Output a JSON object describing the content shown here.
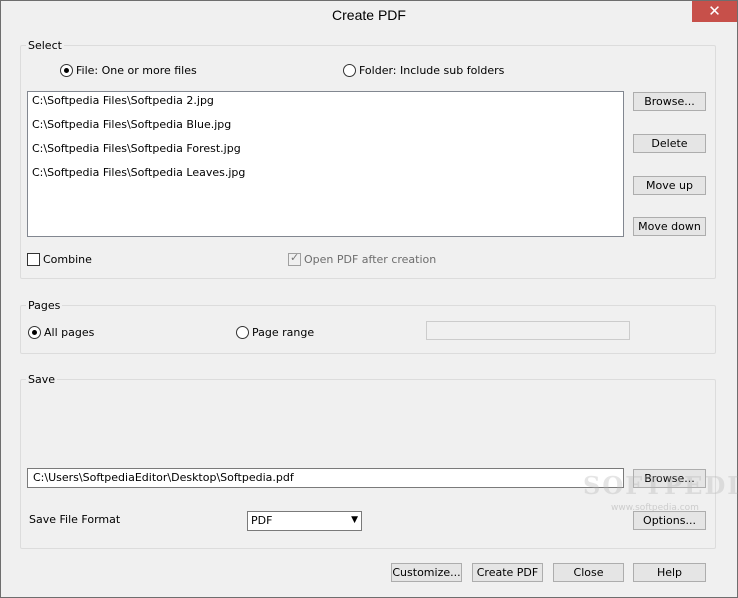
{
  "window": {
    "title": "Create PDF",
    "close_glyph": "✕"
  },
  "select_group": {
    "label": "Select",
    "radio_files": "File: One or more files",
    "radio_folder": "Folder: Include sub folders",
    "files": [
      "C:\\Softpedia Files\\Softpedia 2.jpg",
      "C:\\Softpedia Files\\Softpedia Blue.jpg",
      "C:\\Softpedia Files\\Softpedia Forest.jpg",
      "C:\\Softpedia Files\\Softpedia Leaves.jpg"
    ],
    "browse": "Browse...",
    "delete": "Delete",
    "move_up": "Move up",
    "move_down": "Move down",
    "combine": "Combine",
    "open_after": "Open PDF after creation"
  },
  "pages_group": {
    "label": "Pages",
    "all_pages": "All pages",
    "page_range": "Page range",
    "range_value": ""
  },
  "save_group": {
    "label": "Save",
    "path": "C:\\Users\\SoftpediaEditor\\Desktop\\Softpedia.pdf",
    "browse": "Browse...",
    "format_label": "Save File Format",
    "format_value": "PDF",
    "options": "Options..."
  },
  "footer": {
    "customize": "Customize...",
    "create": "Create PDF",
    "close": "Close",
    "help": "Help"
  },
  "watermark": {
    "text": "SOFTPEDIA",
    "sub": "www.softpedia.com"
  }
}
